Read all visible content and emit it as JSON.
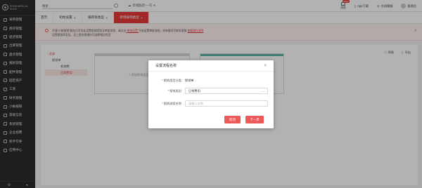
{
  "brand": {
    "line1": "RDGB MEDICAL",
    "line2": "SUITE"
  },
  "sidebar": {
    "items": [
      {
        "label": "采购管理",
        "icon": "cart-icon"
      },
      {
        "label": "库存管理",
        "icon": "box-icon"
      },
      {
        "label": "退货管理",
        "icon": "return-icon"
      },
      {
        "label": "出库管理",
        "icon": "truck-icon"
      },
      {
        "label": "盘点管理",
        "icon": "clipboard-icon"
      },
      {
        "label": "报损管理",
        "icon": "warning-icon"
      },
      {
        "label": "配件管理",
        "icon": "tool-icon"
      },
      {
        "label": "固定资产",
        "icon": "building-icon"
      },
      {
        "label": "工资",
        "icon": "wallet-icon"
      },
      {
        "label": "财务管理",
        "icon": "chart-icon"
      },
      {
        "label": "小帐报销",
        "icon": "receipt-icon"
      },
      {
        "label": "基础信息",
        "icon": "info-icon"
      },
      {
        "label": "系统管理",
        "icon": "gear-icon"
      },
      {
        "label": "企业招聘",
        "icon": "users-icon"
      },
      {
        "label": "新手引导",
        "icon": "guide-icon"
      },
      {
        "label": "应用中心",
        "icon": "grid-icon"
      }
    ],
    "bottom_icons": [
      "gear-icon",
      "arrow-left-icon"
    ]
  },
  "topbar": {
    "search_placeholder": "搜索",
    "shop": "华润医药·一号",
    "messages": "消息",
    "messages_badge": "NEW",
    "app": "App下载",
    "service": "在线客服",
    "user": "管理员"
  },
  "tabs": [
    {
      "label": "首页",
      "closable": false,
      "active": false
    },
    {
      "label": "初始设置",
      "closable": true,
      "active": false
    },
    {
      "label": "报销单类型",
      "closable": true,
      "active": false
    },
    {
      "label": "新增报销类型",
      "closable": true,
      "active": true
    }
  ],
  "notice": {
    "line1_before": "开通\"小帐报销\"服务后可在此设置报销类型及审批流程，请点击",
    "line1_link": "\"报销设置\"",
    "line1_after": "开始设置审批流程，如有疑问可联系客服",
    "line1_link2": "查看操作说明",
    "line2": "设置报销类型后，员工提交报销时可选择相应类型"
  },
  "tree": {
    "root": "全部",
    "child": "报销单",
    "leaf1": "差旅费",
    "leaf2": "日常费用"
  },
  "actions": {
    "help": "帮助",
    "export": "导出"
  },
  "card": {
    "add_label": "添加报销类型"
  },
  "modal": {
    "title": "设置流程名称",
    "field1_label": "报销类型分类:",
    "field1_value": "报销单",
    "field2_label": "报销类型:",
    "field2_value": "日常费用",
    "field3_label": "报销流程名称:",
    "field3_placeholder": "请输入名称",
    "cancel": "取消",
    "next": "下一步"
  },
  "colors": {
    "accent": "#e83a3a",
    "sidebar": "#2b2b2b",
    "button": "#ec5a5a"
  }
}
